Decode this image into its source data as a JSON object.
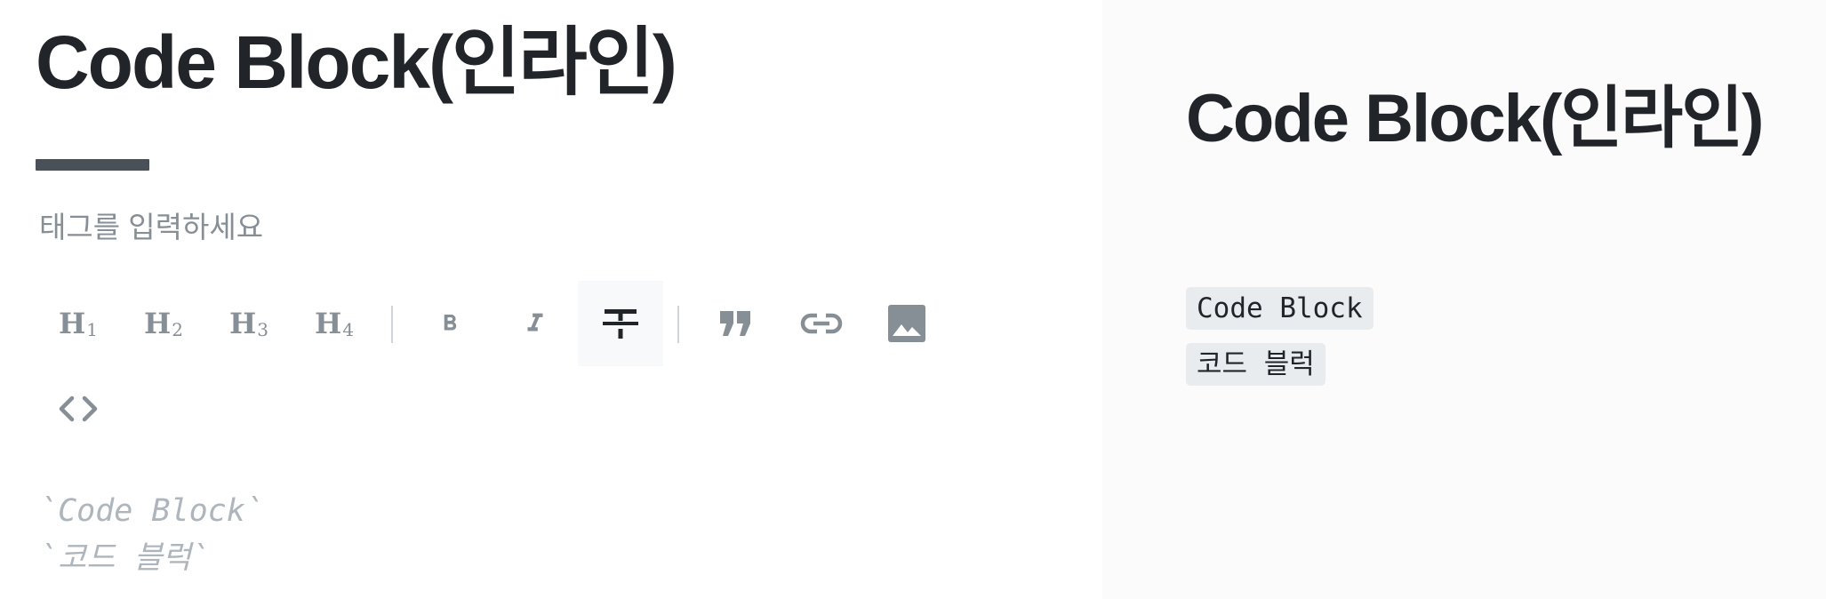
{
  "editor": {
    "title": "Code Block(인라인)",
    "tag_placeholder": "태그를 입력하세요",
    "toolbar": {
      "h1": "H",
      "h1_sub": "1",
      "h2": "H",
      "h2_sub": "2",
      "h3": "H",
      "h3_sub": "3",
      "h4": "H",
      "h4_sub": "4",
      "icons": [
        "bold-icon",
        "italic-icon",
        "strikethrough-icon",
        "quote-icon",
        "link-icon",
        "image-icon",
        "code-icon"
      ],
      "active": "strikethrough"
    },
    "content_lines": [
      "`Code Block`",
      "`코드 블럭`"
    ]
  },
  "preview": {
    "title": "Code Block(인라인)",
    "code_items": [
      "Code Block",
      "코드 블럭"
    ]
  },
  "colors": {
    "text_dark": "#212529",
    "icon_gray": "#868e96",
    "rule": "#495057",
    "preview_bg": "#fbfbfb",
    "code_bg": "#e9ecef"
  }
}
